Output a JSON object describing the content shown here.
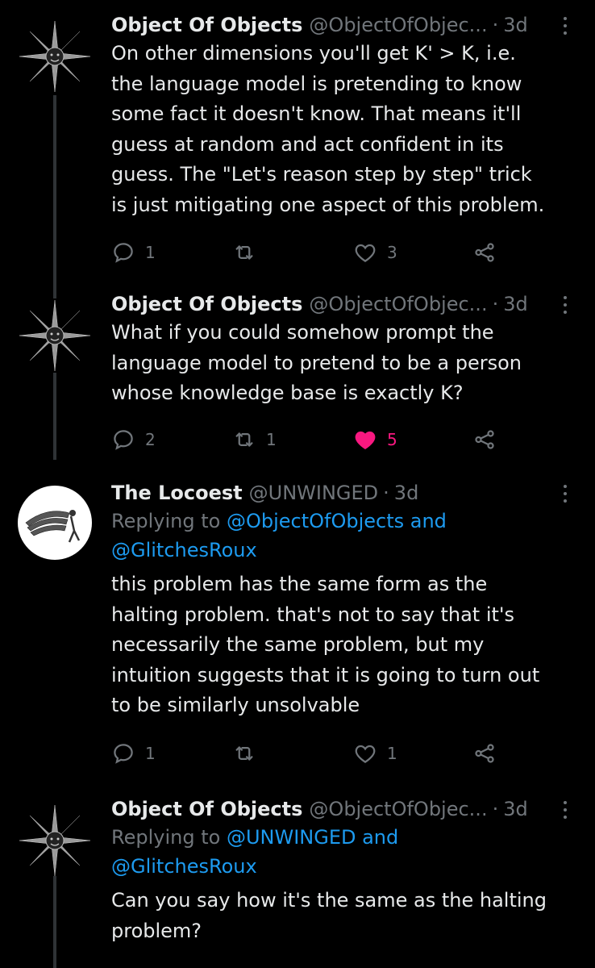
{
  "tweets": [
    {
      "author": "Object Of Objects",
      "handle": "@ObjectOfObjec...",
      "time": "3d",
      "reply_prefix": "",
      "reply_users": "",
      "reply_users2": "",
      "lines": [
        "On other dimensions you'll get K' > K, i.e.",
        "the language model is pretending to know",
        "some fact it doesn't know. That means it'll",
        "guess at random and act confident in its",
        "guess. The \"Let's reason step by step\" trick",
        "is just mitigating one aspect of this problem."
      ],
      "replies": "1",
      "retweets": "",
      "likes": "3",
      "liked": false,
      "avatar": "compass-rose-avatar"
    },
    {
      "author": "Object Of Objects",
      "handle": "@ObjectOfObjec...",
      "time": "3d",
      "lines": [
        "What if you could somehow prompt the",
        "language model to pretend to be a person",
        "whose knowledge base is exactly K?"
      ],
      "replies": "2",
      "retweets": "1",
      "likes": "5",
      "liked": true,
      "avatar": "compass-rose-avatar"
    },
    {
      "author": "The Locoest",
      "handle": "@UNWINGED",
      "time": "3d",
      "reply_prefix": "Replying to ",
      "reply_users": "@ObjectOfObjects and",
      "reply_users2": "@GlitchesRoux",
      "lines": [
        "this problem has the same form as the",
        "halting problem. that's not to say that it's",
        "necessarily the same problem, but my",
        "intuition suggests that it is going to turn out",
        "to be similarly unsolvable"
      ],
      "replies": "1",
      "retweets": "",
      "likes": "1",
      "liked": false,
      "avatar": "winged-figure-avatar"
    },
    {
      "author": "Object Of Objects",
      "handle": "@ObjectOfObjec...",
      "time": "3d",
      "reply_prefix": "Replying to ",
      "reply_users": "@UNWINGED and",
      "reply_users2": "@GlitchesRoux",
      "lines": [
        "Can you say how it's the same as the halting",
        "problem?"
      ],
      "avatar": "compass-rose-avatar"
    }
  ],
  "colors": {
    "background": "#000000",
    "text": "#e7e9ea",
    "muted": "#71767b",
    "link": "#1d9bf0",
    "like": "#f91880",
    "thread_line": "#2f3336"
  }
}
